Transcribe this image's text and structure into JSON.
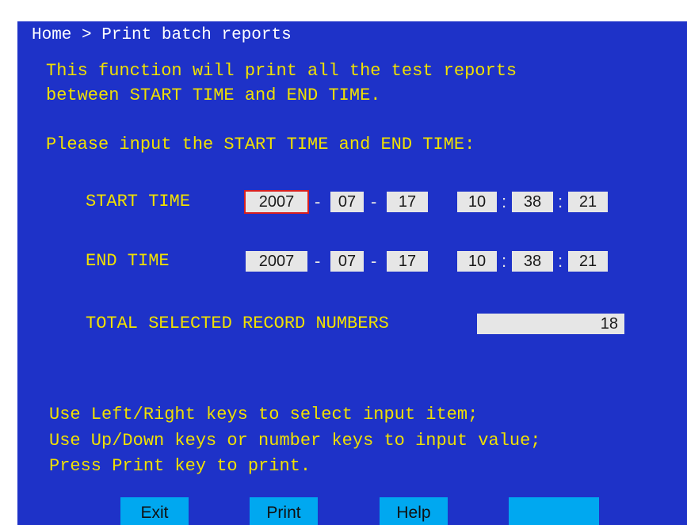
{
  "breadcrumb": {
    "home": "Home",
    "separator": ">",
    "current": "Print batch reports"
  },
  "description": [
    "This function will print all the test reports",
    "between START TIME and END TIME."
  ],
  "prompt": "Please input the START TIME and END TIME:",
  "start_time": {
    "label": "START TIME",
    "year": "2007",
    "month": "07",
    "day": "17",
    "hour": "10",
    "minute": "38",
    "second": "21"
  },
  "end_time": {
    "label": "END TIME",
    "year": "2007",
    "month": "07",
    "day": "17",
    "hour": "10",
    "minute": "38",
    "second": "21"
  },
  "date_separator": "-",
  "time_separator": ":",
  "total": {
    "label": "TOTAL SELECTED RECORD NUMBERS",
    "value": "18"
  },
  "hints": [
    "Use Left/Right keys to select input item;",
    "Use Up/Down keys or number keys to input value;",
    "Press Print key to print."
  ],
  "buttons": {
    "exit": "Exit",
    "print": "Print",
    "help": "Help",
    "blank": ""
  },
  "colors": {
    "background": "#1e32c8",
    "text_yellow": "#f0e000",
    "field": "#e6e6e6",
    "focus": "#d82020",
    "button": "#00a8f0"
  }
}
